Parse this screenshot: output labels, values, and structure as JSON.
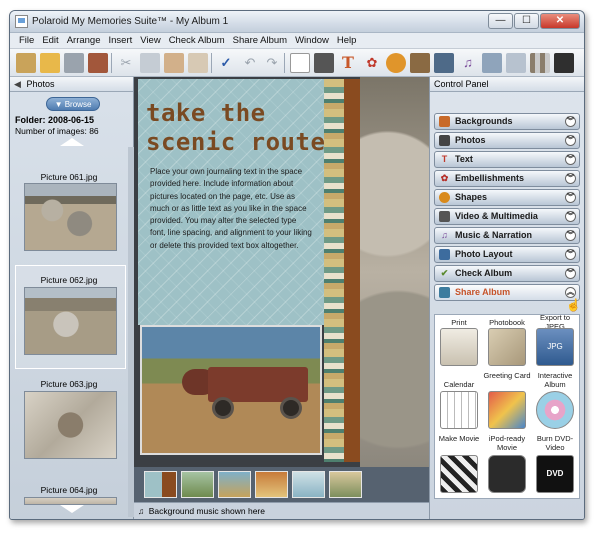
{
  "window": {
    "title": "Polaroid My Memories Suite™ - My Album 1",
    "min": "—",
    "max": "☐",
    "close": "✕"
  },
  "menu": [
    "File",
    "Edit",
    "Arrange",
    "Insert",
    "View",
    "Check Album",
    "Share Album",
    "Window",
    "Help"
  ],
  "toolbar_icons": [
    "select-icon",
    "open-folder-icon",
    "save-icon",
    "print-icon",
    "cut-icon",
    "copy-icon",
    "paste-icon",
    "delete-icon",
    "spellcheck-icon",
    "undo-icon",
    "redo-icon",
    "new-page-icon",
    "camera-icon",
    "text-icon",
    "flower-icon",
    "shape-icon",
    "brush-icon",
    "video-icon",
    "music-icon",
    "layout-icon",
    "grid-icon",
    "film-icon",
    "share-icon"
  ],
  "photos_panel": {
    "title": "Photos",
    "browse": "Browse",
    "folder_label": "Folder:",
    "folder": "2008-06-15",
    "count_label": "Number of images:",
    "count": "86",
    "pictures": [
      "Picture 061.jpg",
      "Picture 062.jpg",
      "Picture 063.jpg",
      "Picture 064.jpg"
    ]
  },
  "page": {
    "headline": [
      "take the",
      "scenic route"
    ],
    "journal_text": "Place your own journaling text in the space provided here. Include information about pictures located on the page, etc. Use as much or as little text as you like in the space provided. You may alter the selected type font, line spacing, and alignment to your liking or delete this provided text box altogether."
  },
  "status": {
    "music_note": "♫",
    "text": "Background music shown here"
  },
  "control_panel": {
    "title": "Control Panel",
    "items": [
      {
        "label": "Backgrounds",
        "icon": "backgrounds-icon",
        "color": "#c86a2a"
      },
      {
        "label": "Photos",
        "icon": "photos-icon",
        "color": "#444444"
      },
      {
        "label": "Text",
        "icon": "text-icon",
        "color": "#c0392b"
      },
      {
        "label": "Embellishments",
        "icon": "embellishments-icon",
        "color": "#b5302a"
      },
      {
        "label": "Shapes",
        "icon": "shapes-icon",
        "color": "#d98a1c"
      },
      {
        "label": "Video & Multimedia",
        "icon": "video-icon",
        "color": "#555555"
      },
      {
        "label": "Music & Narration",
        "icon": "music-icon",
        "color": "#7a4b9a"
      },
      {
        "label": "Photo Layout",
        "icon": "layout-icon",
        "color": "#3d6c9e"
      },
      {
        "label": "Check Album",
        "icon": "check-icon",
        "color": "#5a8a2e"
      },
      {
        "label": "Share Album",
        "icon": "share-icon",
        "color": "#3d7c9e"
      }
    ],
    "share_options": [
      {
        "label": "Print",
        "icon": "printer-icon"
      },
      {
        "label": "Photobook",
        "icon": "photobook-icon"
      },
      {
        "label": "Export to JPEG",
        "icon": "jpeg-export-icon"
      },
      {
        "label": "Calendar",
        "icon": "calendar-icon"
      },
      {
        "label": "Greeting Card",
        "icon": "greeting-card-icon"
      },
      {
        "label": "Interactive Album",
        "icon": "interactive-album-icon"
      },
      {
        "label": "Make Movie",
        "icon": "clapperboard-icon"
      },
      {
        "label": "iPod-ready Movie",
        "icon": "ipod-icon"
      },
      {
        "label": "Burn DVD-Video",
        "icon": "dvd-icon"
      }
    ]
  }
}
